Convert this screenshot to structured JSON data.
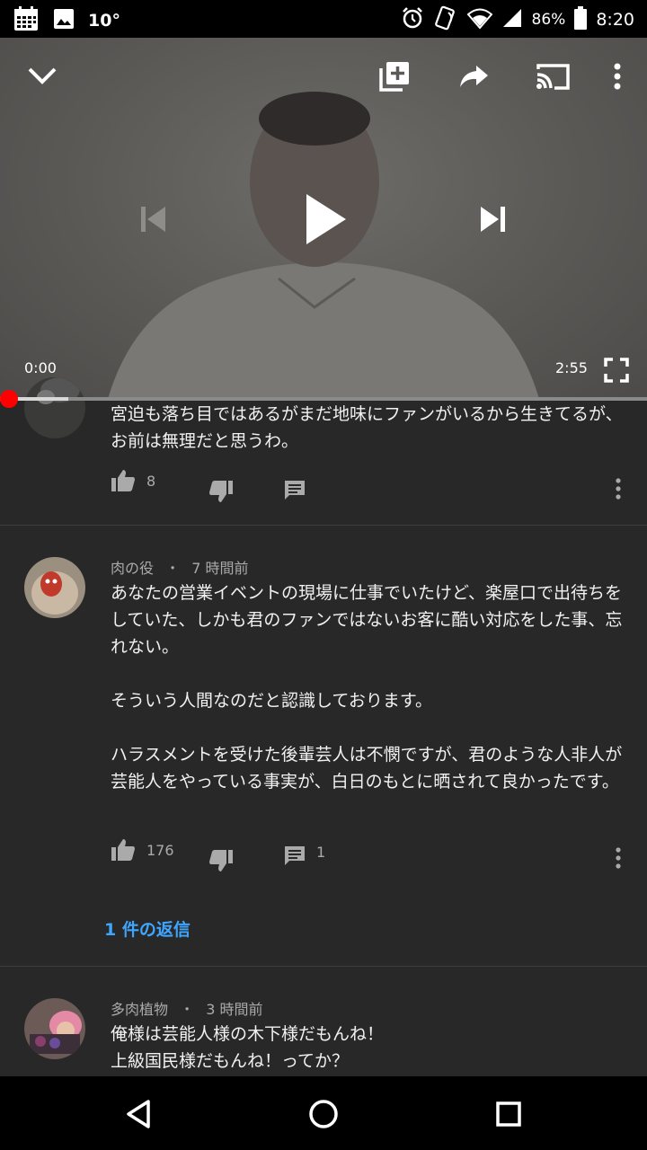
{
  "status_bar": {
    "temperature": "10°",
    "battery": "86%",
    "time": "8:20",
    "icons": [
      "calendar-icon",
      "image-icon",
      "alarm-icon",
      "nfc-icon",
      "wifi-icon",
      "signal-icon",
      "battery-icon"
    ]
  },
  "player": {
    "current_time": "0:00",
    "duration": "2:55",
    "progress": 0.0,
    "buffered": 0.105,
    "icons": [
      "chevron-down-icon",
      "add-to-playlist-icon",
      "share-icon",
      "cast-icon",
      "more-icon",
      "previous-icon",
      "play-icon",
      "next-icon",
      "fullscreen-icon"
    ]
  },
  "comments": [
    {
      "text": "宮迫も落ち目ではあるがまだ地味にファンがいるから生きてるが、お前は無理だと思うわ。",
      "likes": "8",
      "replies_count": ""
    },
    {
      "author": "肉の役",
      "time": "7 時間前",
      "text": "あなたの営業イベントの現場に仕事でいたけど、楽屋口で出待ちをしていた、しかも君のファンではないお客に酷い対応をした事、忘れない。\n\nそういう人間なのだと認識しております。\n\nハラスメントを受けた後輩芸人は不憫ですが、君のような人非人が芸能人をやっている事実が、白日のもとに晒されて良かったです。",
      "likes": "176",
      "replies_count": "1",
      "replies_link": "1 件の返信"
    },
    {
      "author": "多肉植物",
      "time": "3 時間前",
      "text": "俺様は芸能人様の木下様だもんね！\n上級国民様だもんね！ってか？"
    }
  ],
  "meta_separator": "・",
  "colors": {
    "background": "#282828",
    "accent_red": "#ff0000",
    "link_blue": "#3ea6ff",
    "secondary_text": "#aaaaaa"
  },
  "nav_icons": [
    "back-icon",
    "home-icon",
    "recents-icon"
  ]
}
